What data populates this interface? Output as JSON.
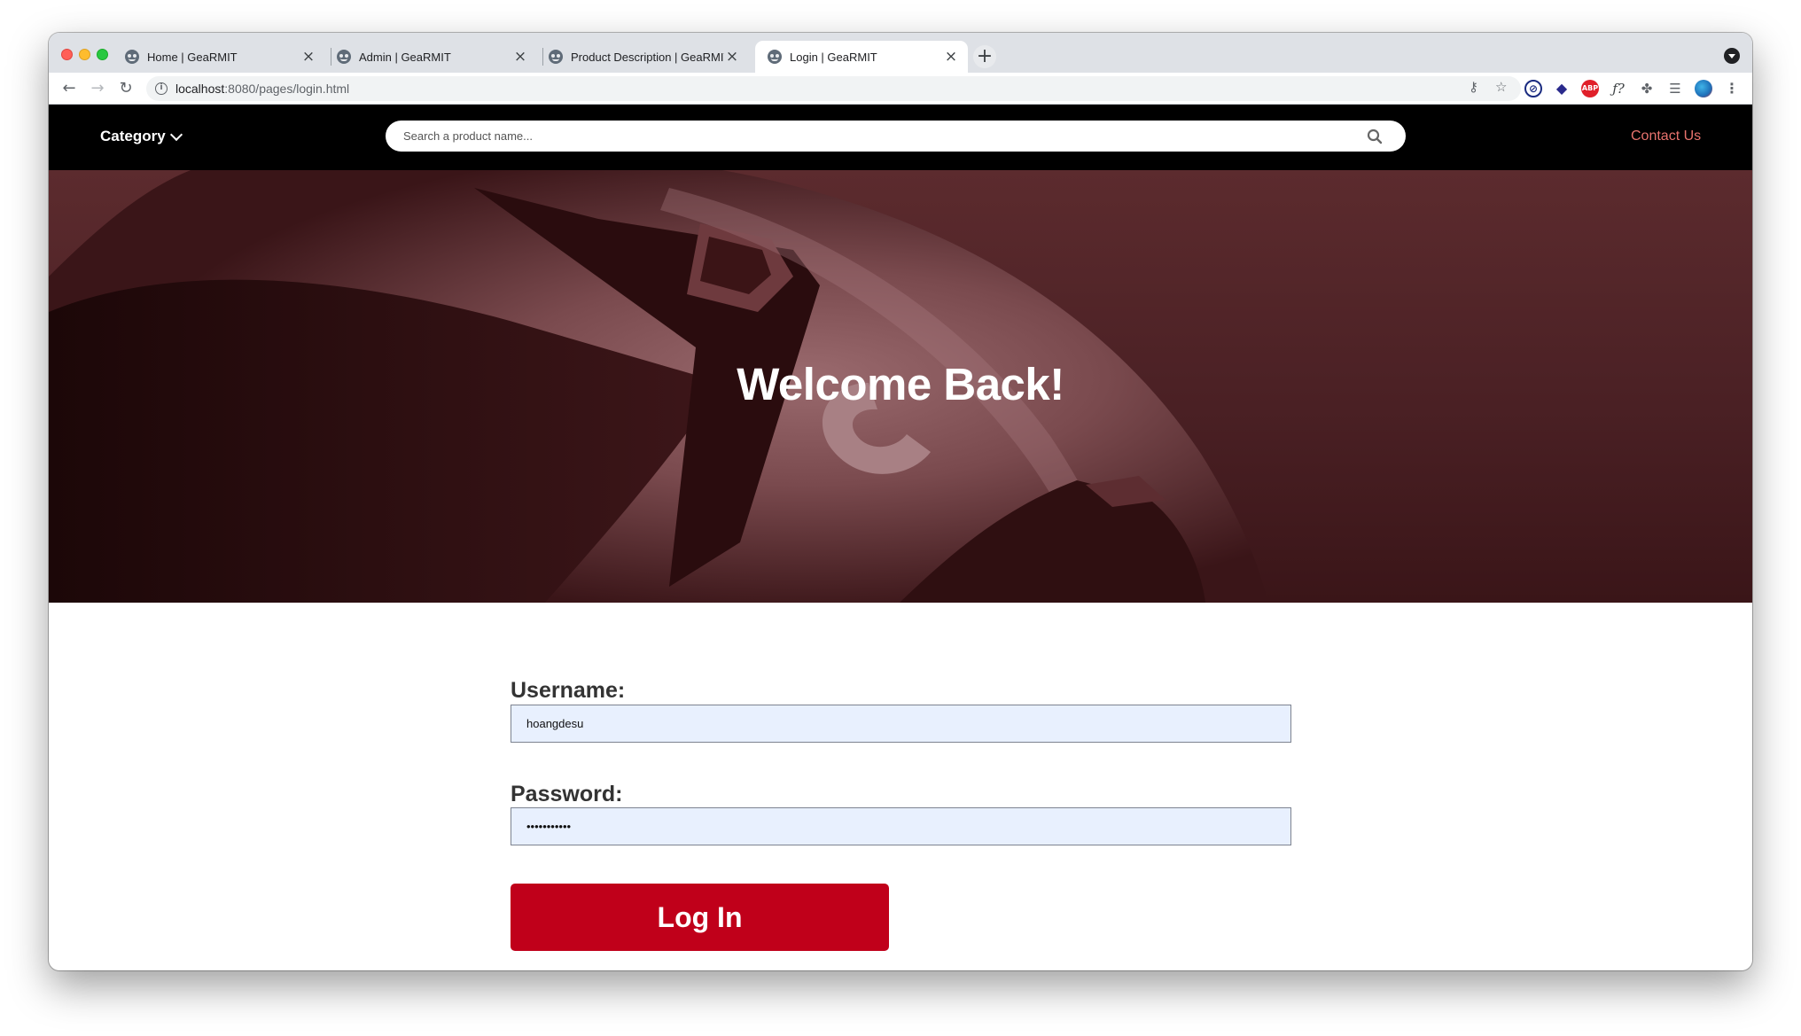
{
  "browser": {
    "tabs": [
      {
        "title": "Home | GeaRMIT",
        "active": false
      },
      {
        "title": "Admin | GeaRMIT",
        "active": false
      },
      {
        "title": "Product Description | GeaRMIT",
        "active": false
      },
      {
        "title": "Login | GeaRMIT",
        "active": true
      }
    ],
    "url_host": "localhost",
    "url_path": ":8080/pages/login.html",
    "extensions": [
      "key-icon",
      "bookmark-star-icon",
      "block-icon",
      "shield-extension-icon",
      "adblock-icon",
      "formula-icon",
      "puzzle-icon",
      "reading-list-icon",
      "profile-avatar"
    ]
  },
  "nav": {
    "category_label": "Category",
    "search_placeholder": "Search a product name...",
    "contact_label": "Contact Us"
  },
  "hero": {
    "title": "Welcome Back!"
  },
  "form": {
    "username_label": "Username:",
    "username_value": "hoangdesu",
    "password_label": "Password:",
    "password_value": "hoangdesu12",
    "submit_label": "Log In"
  },
  "colors": {
    "nav_bg": "#000000",
    "contact_accent": "#e8736e",
    "hero_tint": "#5c2b2e",
    "button_red": "#c0001a",
    "autofill_bg": "#e8f0fe"
  }
}
